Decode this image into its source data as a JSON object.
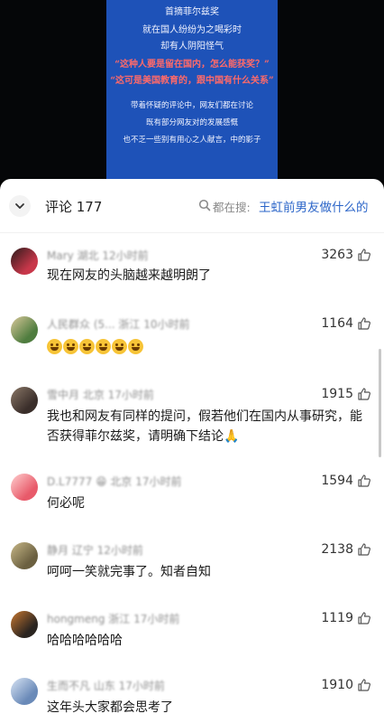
{
  "video": {
    "lines": [
      {
        "text": "首摘菲尔兹奖",
        "style": "normal"
      },
      {
        "text": "就在国人纷纷为之喝彩时",
        "style": "normal"
      },
      {
        "text": "却有人阴阳怪气",
        "style": "normal"
      },
      {
        "text": "“这种人要是留在国内，怎么能获奖？”",
        "style": "red"
      },
      {
        "text": "“这可是美国教育的，跟中国有什么关系”",
        "style": "red"
      },
      {
        "text": "带着怀疑的评论中，网友们都在讨论",
        "style": "small"
      },
      {
        "text": "既有部分网友对的发展感慨",
        "style": "small"
      },
      {
        "text": "也不乏一些别有用心之人献言，中的影子",
        "style": "small"
      }
    ]
  },
  "header": {
    "title": "评论 177",
    "search_prefix": "都在搜:",
    "search_link": "王虹前男友做什么的"
  },
  "comments": [
    {
      "username": "Mary 湖北 12小时前",
      "text": "现在网友的头脑越来越明朗了",
      "likes": "3263",
      "emojis": 0,
      "avatar_color": "#c8374a",
      "avatar_color2": "#2a1a1a"
    },
    {
      "username": "人民群众 (5... 浙江 10小时前",
      "text": "",
      "likes": "1164",
      "emojis": 6,
      "avatar_color": "#4f7d3f",
      "avatar_color2": "#d9c89a"
    },
    {
      "username": "雪中月 北京 17小时前",
      "text": "我也和网友有同样的提问，假若他们在国内从事研究，能否获得菲尔兹奖，请明确下结论🙏",
      "likes": "1915",
      "emojis": 0,
      "avatar_color": "#3a2e2a",
      "avatar_color2": "#8b7868"
    },
    {
      "username": "D.L7777 😁 北京 17小时前",
      "text": "何必呢",
      "likes": "1594",
      "emojis": 0,
      "avatar_color": "#e85a6a",
      "avatar_color2": "#ffd0d0"
    },
    {
      "username": "静月 辽宁 12小时前",
      "text": "呵呵一笑就完事了。知者自知",
      "likes": "2138",
      "emojis": 0,
      "avatar_color": "#6b6040",
      "avatar_color2": "#c8b888"
    },
    {
      "username": "hongmeng 浙江 17小时前",
      "text": "哈哈哈哈哈哈",
      "likes": "1119",
      "emojis": 0,
      "avatar_color": "#2a2420",
      "avatar_color2": "#c87830"
    },
    {
      "username": "生而不凡 山东 17小时前",
      "text": "这年头大家都会思考了",
      "likes": "1910",
      "emojis": 0,
      "avatar_color": "#6a8ab8",
      "avatar_color2": "#d8e4f4"
    }
  ],
  "colors": {
    "link": "#2a64c8",
    "video_bg": "#1e52b8"
  }
}
